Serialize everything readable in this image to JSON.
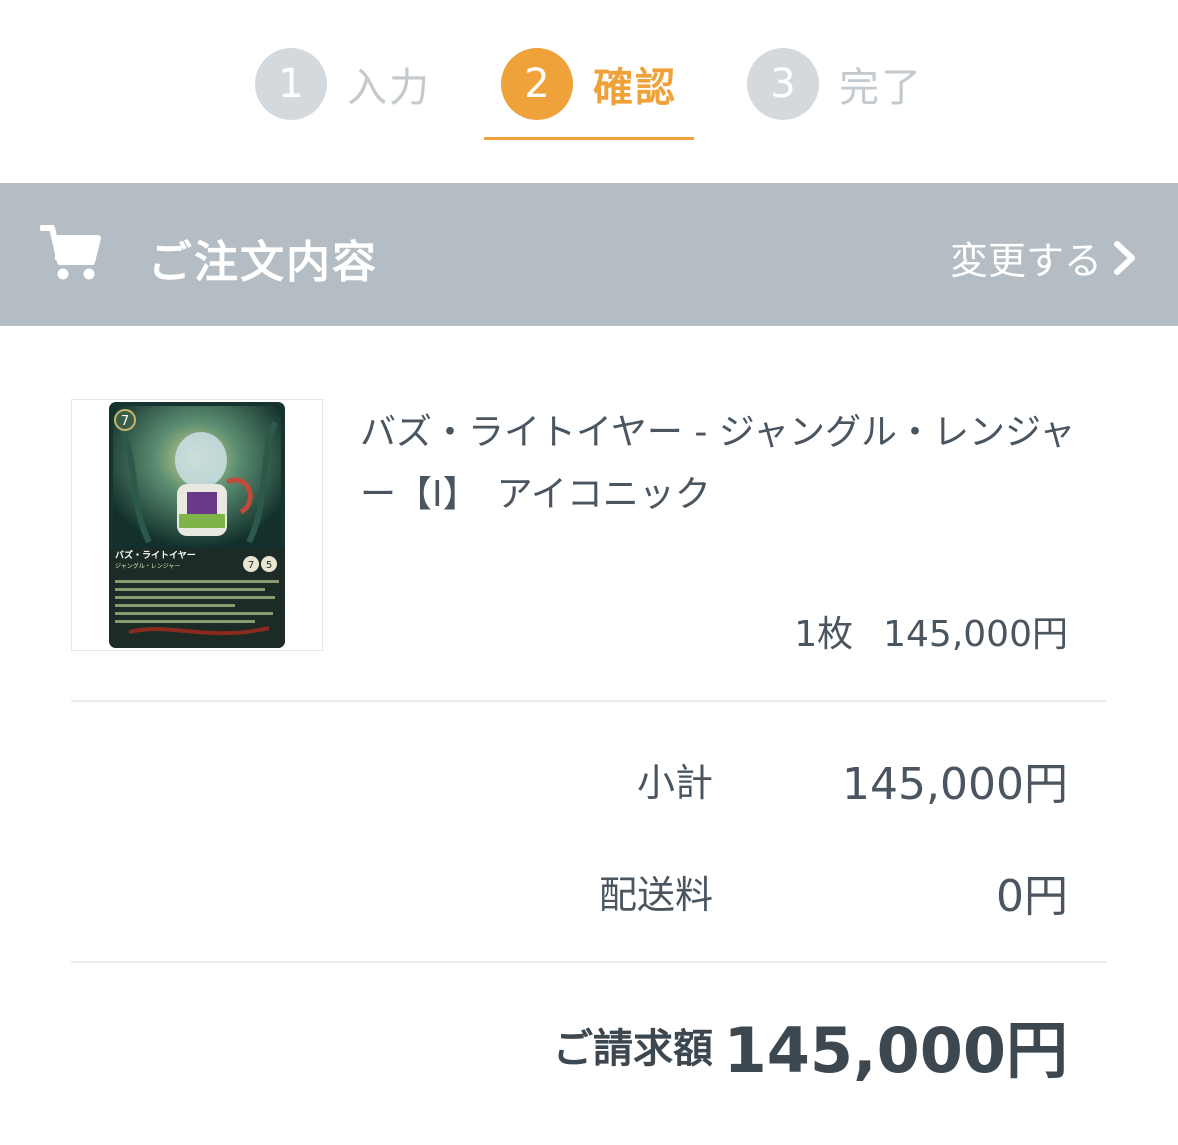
{
  "steps": [
    {
      "number": "1",
      "label": "入力"
    },
    {
      "number": "2",
      "label": "確認"
    },
    {
      "number": "3",
      "label": "完了"
    }
  ],
  "active_step": 2,
  "colors": {
    "accent": "#f0a23a",
    "bar": "#b3bdc3",
    "inactive": "#d3d9dd"
  },
  "order": {
    "title": "ご注文内容",
    "change_label": "変更する",
    "icon": "cart-icon"
  },
  "item": {
    "name": "バズ・ライトイヤー - ジャングル・レンジャー【I】　アイコニック",
    "quantity": "1枚",
    "price": "145,000円",
    "card_text": {
      "cost": "7",
      "name": "バズ・ライトイヤー",
      "subtitle": "ジャングル・レンジャー",
      "strength": "7",
      "willpower": "5"
    }
  },
  "totals": {
    "subtotal_label": "小計",
    "subtotal_value": "145,000円",
    "shipping_label": "配送料",
    "shipping_value": "0円",
    "total_label": "ご請求額",
    "total_value": "145,000円"
  }
}
